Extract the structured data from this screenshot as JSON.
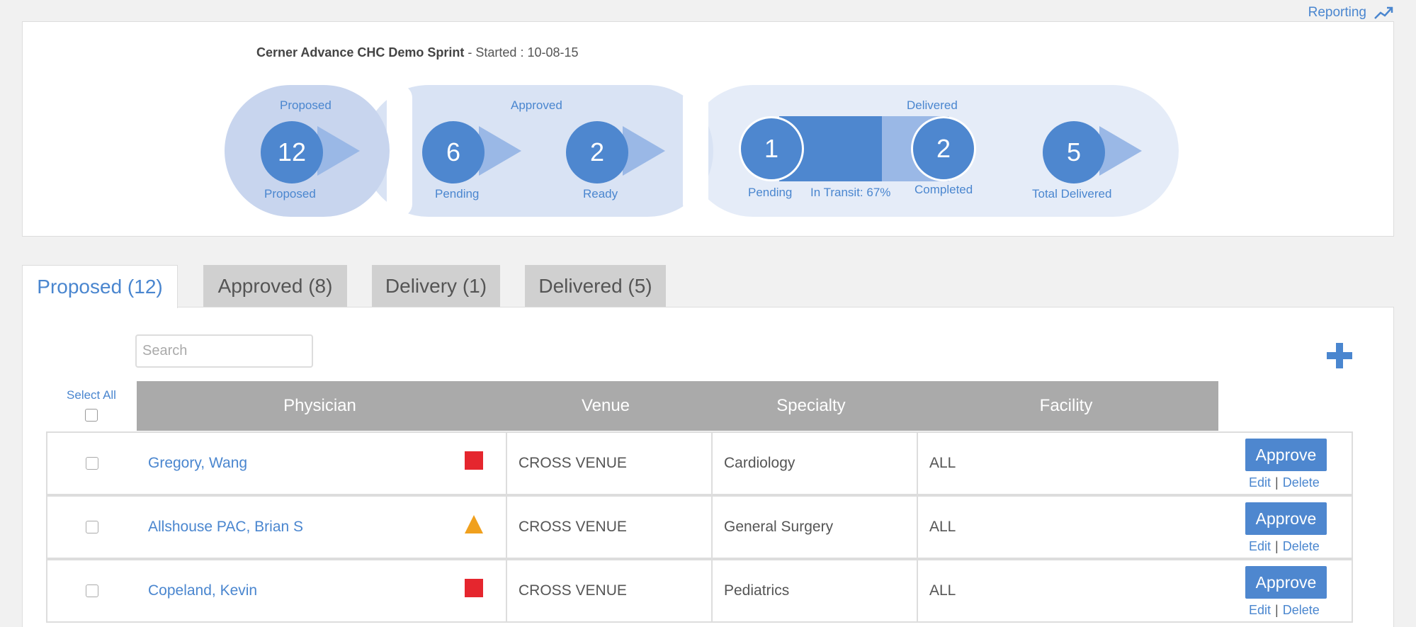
{
  "header": {
    "reporting_label": "Reporting",
    "reporting_icon": "trend-up-icon"
  },
  "sprint": {
    "name": "Cerner Advance CHC Demo Sprint",
    "started_text": " - Started : 10-08-15"
  },
  "pipeline": {
    "proposed": {
      "stage_label": "Proposed",
      "count": "12",
      "sub_label": "Proposed"
    },
    "approved": {
      "stage_label": "Approved",
      "pending": {
        "count": "6",
        "label": "Pending"
      },
      "ready": {
        "count": "2",
        "label": "Ready"
      }
    },
    "delivered": {
      "stage_label": "Delivered",
      "pending": {
        "count": "1",
        "label": "Pending"
      },
      "in_transit_label": "In Transit: 67%",
      "in_transit_progress": 0.67,
      "completed": {
        "count": "2",
        "label": "Completed"
      },
      "total": {
        "count": "5",
        "label": "Total Delivered"
      }
    },
    "colors": {
      "primary": "#4e87cf",
      "arrow": "#9ab8e6"
    }
  },
  "tabs": [
    {
      "label": "Proposed (12)",
      "active": true
    },
    {
      "label": "Approved (8)",
      "active": false
    },
    {
      "label": "Delivery (1)",
      "active": false
    },
    {
      "label": "Delivered (5)",
      "active": false
    }
  ],
  "toolbar": {
    "search_placeholder": "Search",
    "search_value": "",
    "add_icon": "plus-icon"
  },
  "table": {
    "select_all_label": "Select All",
    "columns": [
      "Physician",
      "Venue",
      "Specialty",
      "Facility"
    ],
    "rows": [
      {
        "physician": "Gregory, Wang",
        "flag": "red-square",
        "venue": "CROSS VENUE",
        "specialty": "Cardiology",
        "facility": "ALL",
        "approve": "Approve",
        "edit": "Edit",
        "delete": "Delete"
      },
      {
        "physician": "Allshouse PAC, Brian S",
        "flag": "orange-triangle",
        "venue": "CROSS VENUE",
        "specialty": "General Surgery",
        "facility": "ALL",
        "approve": "Approve",
        "edit": "Edit",
        "delete": "Delete"
      },
      {
        "physician": "Copeland, Kevin",
        "flag": "red-square",
        "venue": "CROSS VENUE",
        "specialty": "Pediatrics",
        "facility": "ALL",
        "approve": "Approve",
        "edit": "Edit",
        "delete": "Delete"
      }
    ]
  }
}
